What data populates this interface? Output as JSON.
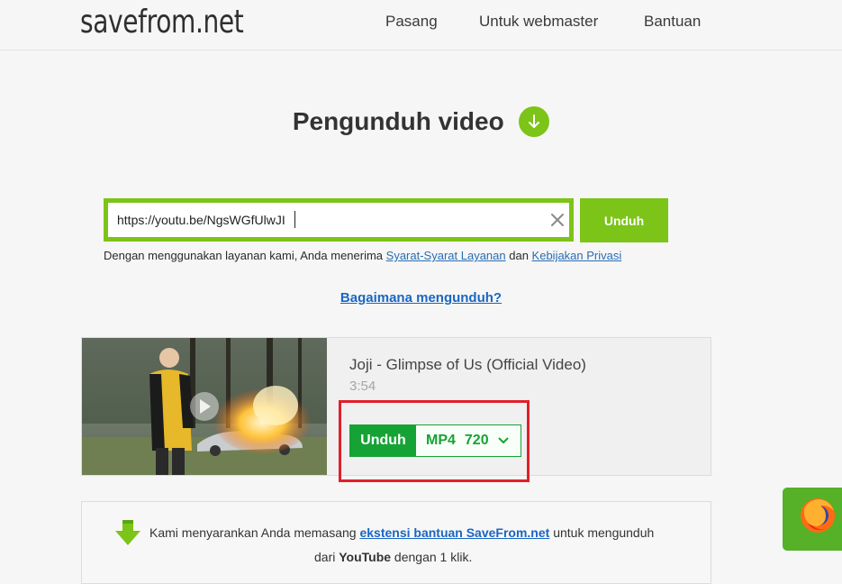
{
  "header": {
    "logo": "savefrom.net",
    "nav": [
      "Pasang",
      "Untuk webmaster",
      "Bantuan"
    ]
  },
  "main": {
    "title": "Pengunduh video",
    "search": {
      "value": "https://youtu.be/NgsWGfUlwJI",
      "button": "Unduh"
    },
    "terms": {
      "prefix": "Dengan menggunakan layanan kami, Anda menerima ",
      "link1": "Syarat-Syarat Layanan",
      "middle": " dan ",
      "link2": "Kebijakan Privasi"
    },
    "howto": "Bagaimana mengunduh?"
  },
  "result": {
    "title": "Joji - Glimpse of Us (Official Video)",
    "duration": "3:54",
    "download_label": "Unduh",
    "format": "MP4",
    "quality": "720"
  },
  "recommendation": {
    "text1": "Kami menyarankan Anda memasang ",
    "link": "ekstensi bantuan SaveFrom.net",
    "text2": " untuk mengunduh",
    "text3": "dari ",
    "bold": "YouTube",
    "text4": " dengan 1 klik."
  },
  "colors": {
    "accent": "#7cc417",
    "download_green": "#16a335",
    "highlight_red": "#e0202a",
    "link_blue": "#1a66c2"
  },
  "icons": [
    "download-arrow-icon",
    "clear-icon",
    "play-icon",
    "chevron-down-icon",
    "firefox-icon"
  ]
}
